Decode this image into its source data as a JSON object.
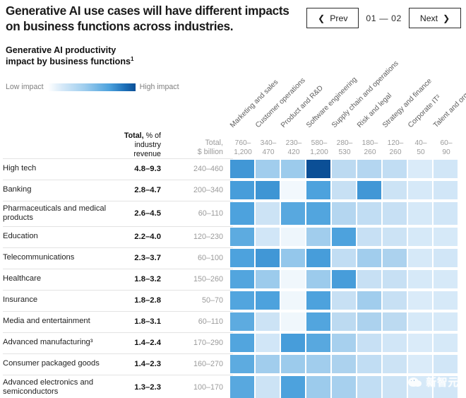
{
  "header": {
    "headline": "Generative AI use cases will have different impacts on business functions across industries.",
    "prev_label": "Prev",
    "next_label": "Next",
    "page_count": "01 — 02",
    "prev_icon": "chevron-left-icon",
    "next_icon": "chevron-right-icon"
  },
  "subtitle": {
    "line1": "Generative AI productivity",
    "line2": "impact by business functions",
    "footnote_marker": "1"
  },
  "legend": {
    "low_label": "Low impact",
    "high_label": "High impact",
    "low_color": "#ffffff",
    "high_color": "#0b4f96"
  },
  "table_headers": {
    "row_label_header": "",
    "total_pct_header_bold": "Total,",
    "total_pct_header_rest": " % of",
    "total_pct_header_line2": "industry",
    "total_pct_header_line3": "revenue",
    "total_bn_header_line1": "Total,",
    "total_bn_header_line2": "$ billion"
  },
  "watermark": {
    "text": "新智元",
    "icon": "wechat-icon"
  },
  "chart_data": {
    "type": "heatmap",
    "title": "Generative AI productivity impact by business functions",
    "xlabel": "",
    "ylabel": "",
    "legend_position": "top-left",
    "color_low": "#ffffff",
    "color_high": "#0b4f96",
    "columns": [
      {
        "label": "Marketing and sales",
        "total_bn_line1": "760–",
        "total_bn_line2": "1,200"
      },
      {
        "label": "Customer operations",
        "total_bn_line1": "340–",
        "total_bn_line2": "470"
      },
      {
        "label": "Product and R&D",
        "total_bn_line1": "230–",
        "total_bn_line2": "420"
      },
      {
        "label": "Software engineering",
        "total_bn_line1": "580–",
        "total_bn_line2": "1,200"
      },
      {
        "label": "Supply chain and operations",
        "total_bn_line1": "280–",
        "total_bn_line2": "530"
      },
      {
        "label": "Risk and legal",
        "total_bn_line1": "180–",
        "total_bn_line2": "260"
      },
      {
        "label": "Strategy and finance",
        "total_bn_line1": "120–",
        "total_bn_line2": "260"
      },
      {
        "label": "Corporate IT²",
        "total_bn_line1": "40–",
        "total_bn_line2": "50"
      },
      {
        "label": "Talent and organization",
        "total_bn_line1": "60–",
        "total_bn_line2": "90"
      }
    ],
    "rows": [
      {
        "industry": "High tech",
        "total_pct": "4.8–9.3",
        "total_bn": "240–460",
        "values": [
          0.62,
          0.4,
          0.42,
          1.0,
          0.3,
          0.33,
          0.28,
          0.18,
          0.22
        ],
        "tall": false
      },
      {
        "industry": "Banking",
        "total_pct": "2.8–4.7",
        "total_bn": "200–340",
        "values": [
          0.6,
          0.63,
          0.06,
          0.58,
          0.26,
          0.62,
          0.24,
          0.2,
          0.22
        ],
        "tall": false
      },
      {
        "industry": "Pharmaceuticals and medical products",
        "total_pct": "2.6–4.5",
        "total_bn": "60–110",
        "values": [
          0.58,
          0.24,
          0.56,
          0.57,
          0.33,
          0.28,
          0.26,
          0.2,
          0.22
        ],
        "tall": true
      },
      {
        "industry": "Education",
        "total_pct": "2.2–4.0",
        "total_bn": "120–230",
        "values": [
          0.55,
          0.22,
          0.08,
          0.4,
          0.58,
          0.26,
          0.24,
          0.2,
          0.2
        ],
        "tall": false
      },
      {
        "industry": "Telecommunications",
        "total_pct": "2.3–3.7",
        "total_bn": "60–100",
        "values": [
          0.58,
          0.62,
          0.45,
          0.6,
          0.28,
          0.4,
          0.36,
          0.2,
          0.22
        ],
        "tall": false
      },
      {
        "industry": "Healthcare",
        "total_pct": "1.8–3.2",
        "total_bn": "150–260",
        "values": [
          0.57,
          0.42,
          0.07,
          0.42,
          0.6,
          0.26,
          0.26,
          0.2,
          0.2
        ],
        "tall": false
      },
      {
        "industry": "Insurance",
        "total_pct": "1.8–2.8",
        "total_bn": "50–70",
        "values": [
          0.57,
          0.58,
          0.07,
          0.58,
          0.26,
          0.4,
          0.26,
          0.18,
          0.2
        ],
        "tall": false
      },
      {
        "industry": "Media and entertainment",
        "total_pct": "1.8–3.1",
        "total_bn": "60–110",
        "values": [
          0.55,
          0.24,
          0.07,
          0.57,
          0.3,
          0.36,
          0.3,
          0.2,
          0.2
        ],
        "tall": false
      },
      {
        "industry": "Advanced manufacturing³",
        "total_pct": "1.4–2.4",
        "total_bn": "170–290",
        "values": [
          0.57,
          0.22,
          0.6,
          0.56,
          0.38,
          0.26,
          0.22,
          0.18,
          0.2
        ],
        "tall": false
      },
      {
        "industry": "Consumer packaged goods",
        "total_pct": "1.4–2.3",
        "total_bn": "160–270",
        "values": [
          0.55,
          0.4,
          0.42,
          0.4,
          0.36,
          0.28,
          0.24,
          0.18,
          0.22
        ],
        "tall": false
      },
      {
        "industry": "Advanced electronics and semiconductors",
        "total_pct": "1.3–2.3",
        "total_bn": "100–170",
        "values": [
          0.56,
          0.24,
          0.58,
          0.42,
          0.38,
          0.28,
          0.24,
          0.2,
          0.22
        ],
        "tall": true
      }
    ]
  }
}
